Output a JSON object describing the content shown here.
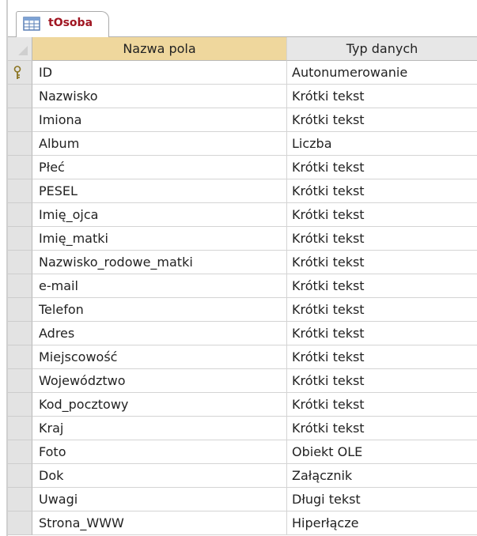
{
  "tab": {
    "label": "tOsoba",
    "icon": "table-icon"
  },
  "columns": {
    "field_name": "Nazwa pola",
    "data_type": "Typ danych"
  },
  "rows": [
    {
      "name": "ID",
      "type": "Autonumerowanie",
      "primary_key": true
    },
    {
      "name": "Nazwisko",
      "type": "Krótki tekst"
    },
    {
      "name": "Imiona",
      "type": "Krótki tekst"
    },
    {
      "name": "Album",
      "type": "Liczba"
    },
    {
      "name": "Płeć",
      "type": "Krótki tekst"
    },
    {
      "name": "PESEL",
      "type": "Krótki tekst"
    },
    {
      "name": "Imię_ojca",
      "type": "Krótki tekst"
    },
    {
      "name": "Imię_matki",
      "type": "Krótki tekst"
    },
    {
      "name": "Nazwisko_rodowe_matki",
      "type": "Krótki tekst"
    },
    {
      "name": "e-mail",
      "type": "Krótki tekst"
    },
    {
      "name": "Telefon",
      "type": "Krótki tekst"
    },
    {
      "name": "Adres",
      "type": "Krótki tekst"
    },
    {
      "name": "Miejscowość",
      "type": "Krótki tekst"
    },
    {
      "name": "Województwo",
      "type": "Krótki tekst"
    },
    {
      "name": "Kod_pocztowy",
      "type": "Krótki tekst"
    },
    {
      "name": "Kraj",
      "type": "Krótki tekst"
    },
    {
      "name": "Foto",
      "type": "Obiekt OLE"
    },
    {
      "name": "Dok",
      "type": "Załącznik"
    },
    {
      "name": "Uwagi",
      "type": "Długi tekst"
    },
    {
      "name": "Strona_WWW",
      "type": "Hiperłącze"
    }
  ],
  "colors": {
    "tab_label": "#a01622",
    "header_active": "#efd79d",
    "header": "#e7e7e7",
    "row_selector": "#e3e3e3"
  }
}
